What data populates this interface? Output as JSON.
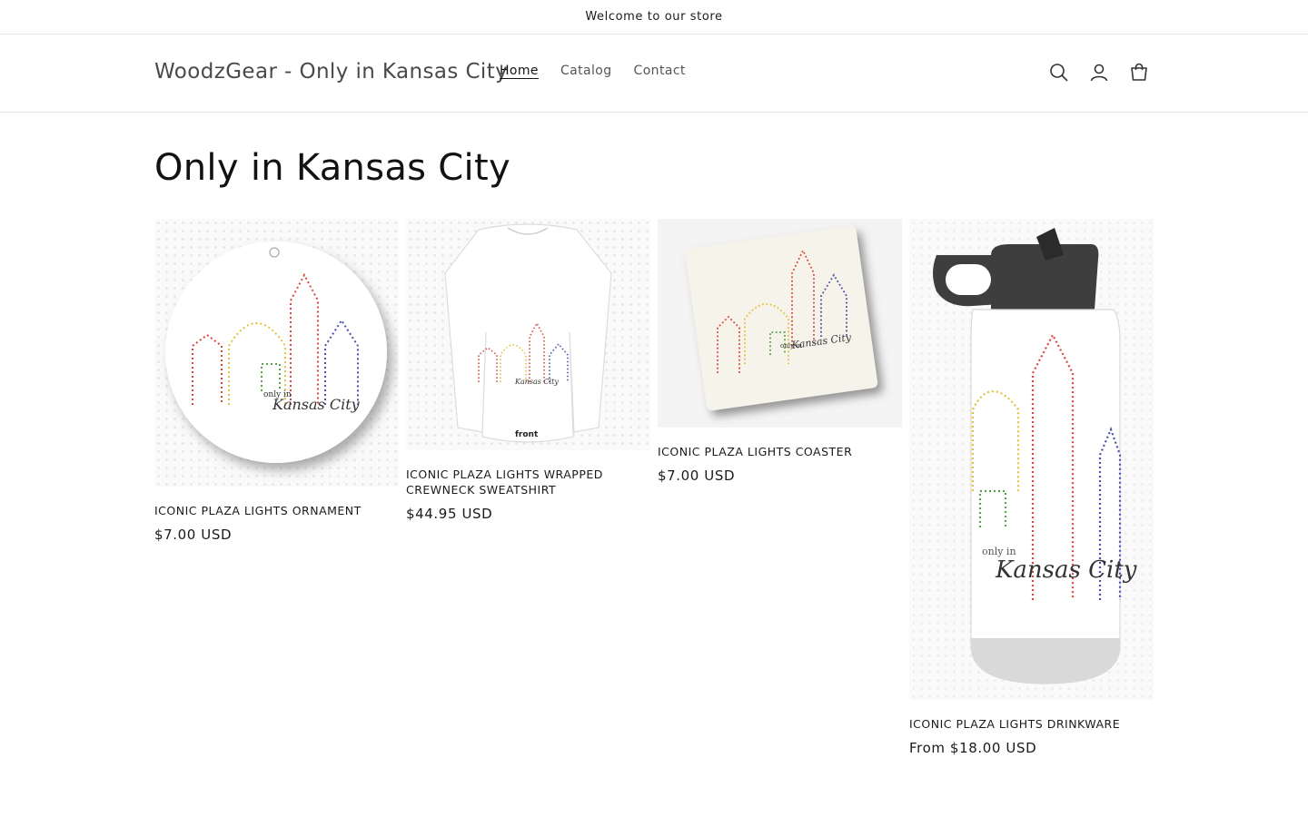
{
  "announcement": {
    "text": "Welcome to our store"
  },
  "header": {
    "logo": "WoodzGear - Only in Kansas City",
    "nav": [
      {
        "label": "Home",
        "active": true
      },
      {
        "label": "Catalog",
        "active": false
      },
      {
        "label": "Contact",
        "active": false
      }
    ],
    "icons": [
      "search-icon",
      "account-icon",
      "cart-icon"
    ]
  },
  "collection": {
    "title": "Only in Kansas City",
    "products": [
      {
        "name": "ICONIC PLAZA LIGHTS ORNAMENT",
        "price": "$7.00 USD"
      },
      {
        "name": "ICONIC PLAZA LIGHTS WRAPPED CREWNECK SWEATSHIRT",
        "price": "$44.95 USD"
      },
      {
        "name": "ICONIC PLAZA LIGHTS COASTER",
        "price": "$7.00 USD"
      },
      {
        "name": "ICONIC PLAZA LIGHTS DRINKWARE",
        "price": "From $18.00 USD"
      }
    ]
  },
  "artwork": {
    "script_small": "only in",
    "script_large": "Kansas City",
    "shirt_tag": "front"
  },
  "colors": {
    "red": "#d9473f",
    "yellow": "#e3c23a",
    "green": "#5aa24a",
    "blue": "#4a4fa8",
    "text": "#121212"
  }
}
